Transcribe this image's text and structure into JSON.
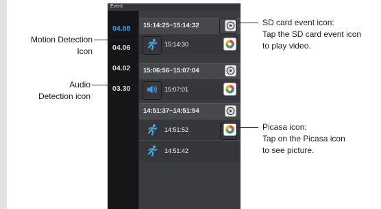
{
  "app": {
    "title": "Event"
  },
  "dates": [
    {
      "label": "04.08",
      "active": true
    },
    {
      "label": "04.06",
      "active": false
    },
    {
      "label": "04.02",
      "active": false
    },
    {
      "label": "03.30",
      "active": false
    }
  ],
  "events": [
    {
      "kind": "range",
      "time": "15:14:25~15:14:32",
      "button": "sd-play"
    },
    {
      "kind": "clip",
      "icon": "motion",
      "time": "15:14:30",
      "button": "picasa"
    },
    {
      "kind": "range",
      "time": "15:06:56~15:07:04",
      "button": "sd-play"
    },
    {
      "kind": "clip",
      "icon": "audio",
      "time": "15:07:01",
      "button": "picasa"
    },
    {
      "kind": "range",
      "time": "14:51:37~14:51:54",
      "button": "sd-play"
    },
    {
      "kind": "clip",
      "icon": "motion",
      "time": "14:51:52",
      "button": "picasa"
    },
    {
      "kind": "clip",
      "icon": "motion",
      "time": "14:51:42",
      "button": "none"
    }
  ],
  "callouts": {
    "motion": [
      "Motion Detection",
      "Icon"
    ],
    "audio": [
      "Audio",
      "Detection icon"
    ],
    "sd": [
      "SD card event icon:",
      "Tap the SD card event icon",
      "to play video."
    ],
    "picasa": [
      "Picasa icon:",
      "Tap on the Picasa icon",
      "to see picture."
    ]
  },
  "colors": {
    "active_date": "#2aa6e8",
    "motion_icon": "#4aa9e6",
    "audio_icon": "#3a9be0",
    "panel_bg": "#2a2a2c"
  }
}
